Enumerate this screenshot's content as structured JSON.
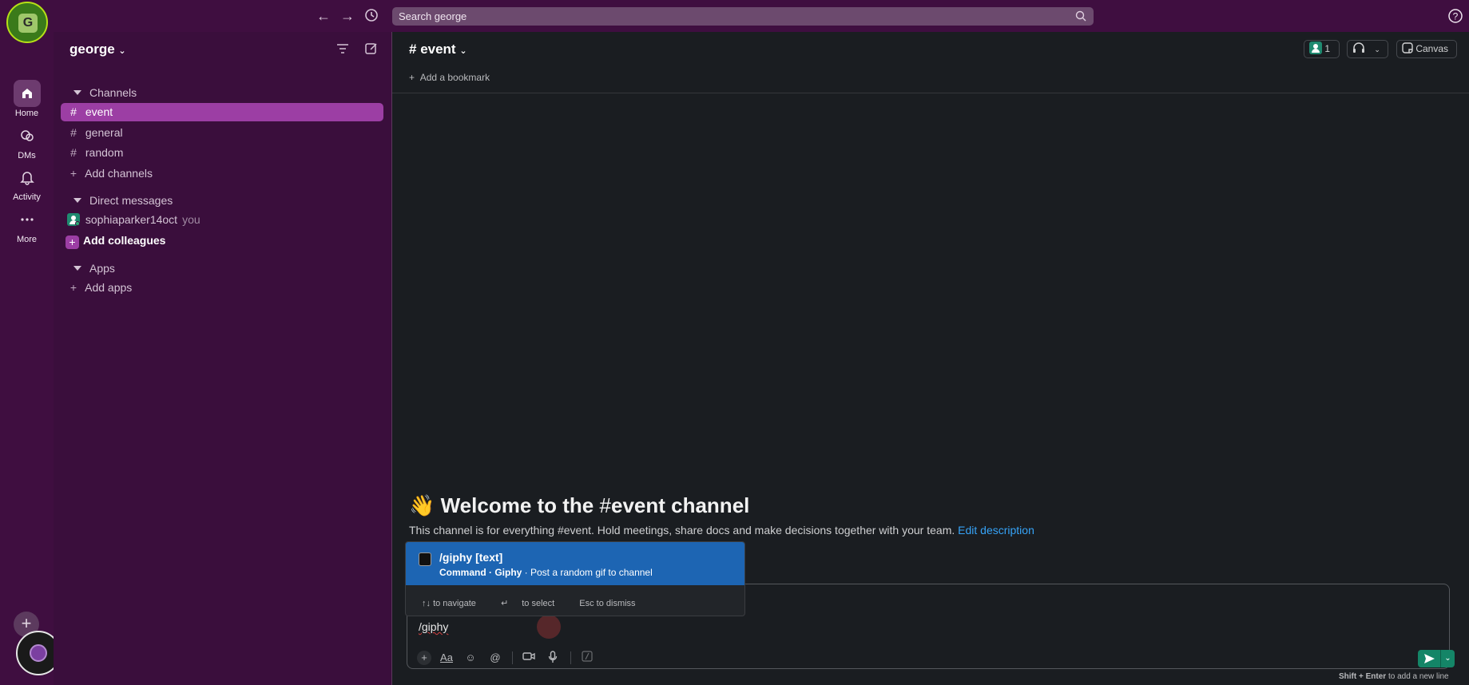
{
  "nav": {
    "back": "←",
    "forward": "→",
    "history": "⟲"
  },
  "search": {
    "placeholder": "Search george"
  },
  "rail": {
    "workspace_initial": "G",
    "items": [
      {
        "label": "Home"
      },
      {
        "label": "DMs"
      },
      {
        "label": "Activity"
      },
      {
        "label": "More"
      }
    ],
    "add": "+"
  },
  "sidebar": {
    "workspace_name": "george",
    "channels_head": "Channels",
    "channels": [
      "event",
      "general",
      "random"
    ],
    "add_channels": "Add channels",
    "dm_head": "Direct messages",
    "dm_user": "sophiaparker14oct",
    "dm_you": "you",
    "add_colleagues": "Add colleagues",
    "apps_head": "Apps",
    "add_apps": "Add apps"
  },
  "channel": {
    "name": "event",
    "bookmark": "Add a bookmark",
    "members_count": "1",
    "canvas": "Canvas",
    "welcome_prefix": "Welcome to the",
    "welcome_channel": "event channel",
    "description": "This channel is for everything #event. Hold meetings, share docs and make decisions together with your team.",
    "edit_description": "Edit description"
  },
  "autocomplete": {
    "title": "/giphy [text]",
    "command_label": "Command · Giphy",
    "command_desc": " · Post a random gif to channel",
    "nav_hint": "to navigate",
    "select_hint": "to select",
    "dismiss_hint": "Esc to dismiss"
  },
  "composer": {
    "text": "/giphy",
    "hint_keys": "Shift + Enter",
    "hint_text": "to add a new line"
  },
  "colors": {
    "sidebar_bg": "#3a0e3c",
    "active_channel": "#9c3ea4",
    "main_bg": "#1a1d21",
    "popup_selected": "#1d65b3",
    "send_button": "#148567",
    "link": "#36a3f7"
  }
}
